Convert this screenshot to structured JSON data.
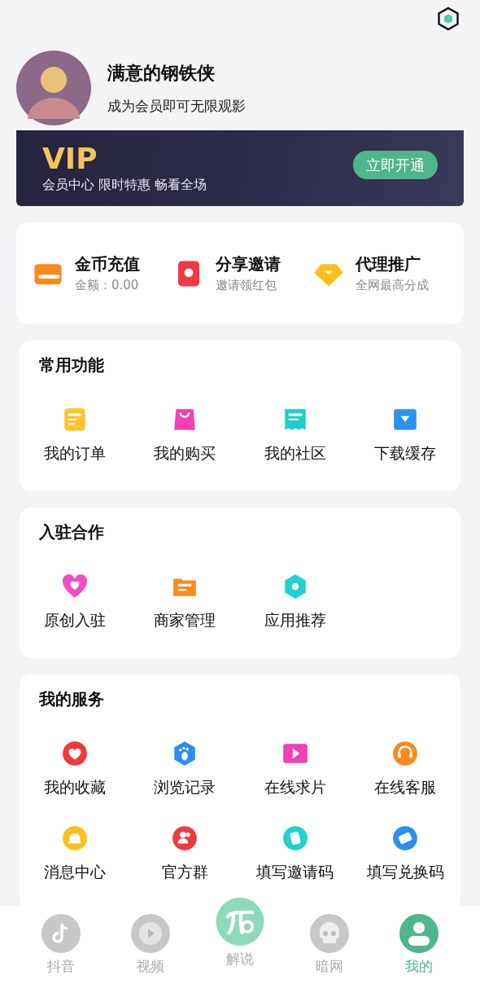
{
  "profile": {
    "name": "满意的钢铁侠",
    "subtitle": "成为会员即可无限观影"
  },
  "vip": {
    "badge": "VIP",
    "tagline": "会员中心 限时特惠 畅看全场",
    "button": "立即开通"
  },
  "quick_actions": [
    {
      "title": "金币充值",
      "subtitle": "金额：0.00"
    },
    {
      "title": "分享邀请",
      "subtitle": "邀请领红包"
    },
    {
      "title": "代理推广",
      "subtitle": "全网最高分成"
    }
  ],
  "sections": [
    {
      "title": "常用功能",
      "items": [
        {
          "label": "我的订单"
        },
        {
          "label": "我的购买"
        },
        {
          "label": "我的社区"
        },
        {
          "label": "下载缓存"
        }
      ]
    },
    {
      "title": "入驻合作",
      "items": [
        {
          "label": "原创入驻"
        },
        {
          "label": "商家管理"
        },
        {
          "label": "应用推荐"
        }
      ]
    },
    {
      "title": "我的服务",
      "items": [
        {
          "label": "我的收藏"
        },
        {
          "label": "浏览记录"
        },
        {
          "label": "在线求片"
        },
        {
          "label": "在线客服"
        },
        {
          "label": "消息中心"
        },
        {
          "label": "官方群"
        },
        {
          "label": "填写邀请码"
        },
        {
          "label": "填写兑换码"
        }
      ]
    }
  ],
  "tab_bar": [
    {
      "label": "抖音",
      "selected": false
    },
    {
      "label": "视频",
      "selected": false
    },
    {
      "label": "解说",
      "selected": false
    },
    {
      "label": "暗网",
      "selected": false
    },
    {
      "label": "我的",
      "selected": true
    }
  ]
}
